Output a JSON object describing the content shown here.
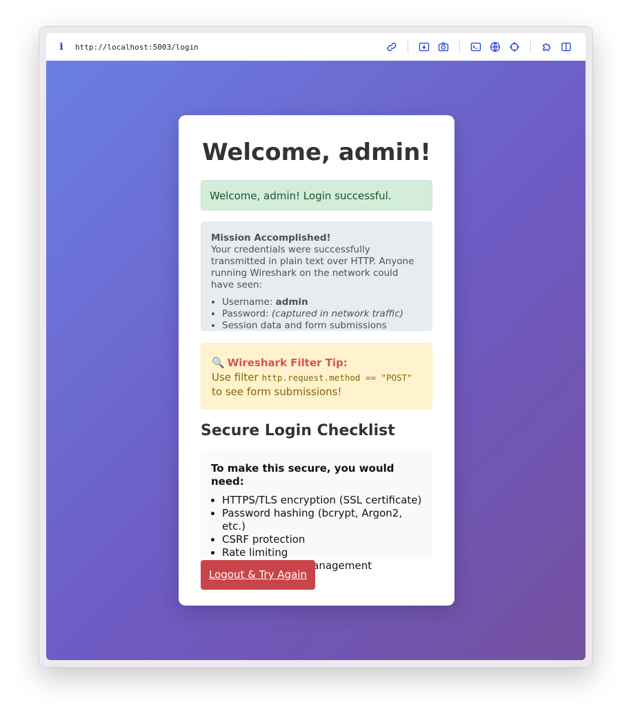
{
  "browser": {
    "url": "http://localhost:5003/login",
    "info_icon": "i",
    "toolbar_icons": [
      "link-icon",
      "download-screenshot-icon",
      "camera-icon",
      "terminal-icon",
      "globe-icon",
      "crosshair-icon",
      "extension-icon",
      "sidebar-icon"
    ]
  },
  "page": {
    "heading": "Welcome, admin!",
    "success_message": "Welcome, admin! Login successful.",
    "mission": {
      "title": "Mission Accomplished!",
      "text": "Your credentials were successfully transmitted in plain text over HTTP. Anyone running Wireshark on the network could have seen:",
      "items": [
        {
          "label": "Username: ",
          "value": "admin"
        },
        {
          "label": "Password: ",
          "value": "(captured in network traffic)"
        },
        {
          "label": "Session data and form submissions",
          "value": ""
        }
      ]
    },
    "tip": {
      "icon": "🔍",
      "title": "Wireshark Filter Tip:",
      "text_before": "Use filter ",
      "code": "http.request.method == \"POST\"",
      "text_after": "to see form submissions!"
    },
    "checklist_heading": "Secure Login Checklist",
    "checklist": {
      "intro": "To make this secure, you would need:",
      "items": [
        "HTTPS/TLS encryption (SSL certificate)",
        "Password hashing (bcrypt, Argon2, etc.)",
        "CSRF protection",
        "Rate limiting",
        "Secure session management"
      ]
    },
    "logout_label": "Logout & Try Again"
  },
  "colors": {
    "accent_icon": "#1d3bd6",
    "gradient_start": "#6a7fe3",
    "gradient_end": "#74509f",
    "logout_button": "#c9444a"
  }
}
